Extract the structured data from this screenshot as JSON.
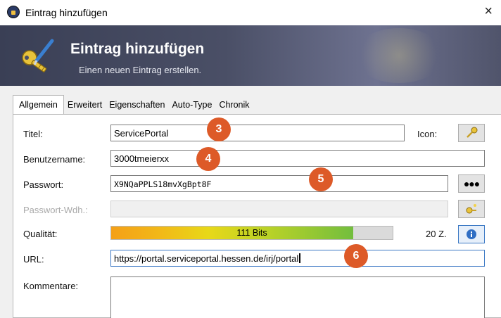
{
  "window": {
    "title": "Eintrag hinzufügen",
    "close_label": "×"
  },
  "banner": {
    "heading": "Eintrag hinzufügen",
    "subheading": "Einen neuen Eintrag erstellen."
  },
  "tabs": [
    {
      "label": "Allgemein",
      "active": true
    },
    {
      "label": "Erweitert",
      "active": false
    },
    {
      "label": "Eigenschaften",
      "active": false
    },
    {
      "label": "Auto-Type",
      "active": false
    },
    {
      "label": "Chronik",
      "active": false
    }
  ],
  "form": {
    "title_label": "Titel:",
    "title_value": "ServicePortal",
    "icon_label": "Icon:",
    "username_label": "Benutzername:",
    "username_value": "3000tmeierxx",
    "password_label": "Passwort:",
    "password_value": "X9NQaPPLS18mvXgBpt8F",
    "password_repeat_label": "Passwort-Wdh.:",
    "password_repeat_value": "",
    "quality_label": "Qualität:",
    "quality_text": "111 Bits",
    "quality_fraction": 0.86,
    "char_count": "20 Z.",
    "url_label": "URL:",
    "url_value": "https://portal.serviceportal.hessen.de/irj/portal",
    "comments_label": "Kommentare:",
    "comments_value": ""
  },
  "annotations": [
    "3",
    "4",
    "5",
    "6"
  ],
  "icons": {
    "app": "lock-icon",
    "banner": "key-pen-icon",
    "icon_picker": "key-icon",
    "show_password": "dots-icon",
    "generate_password": "key-generate-icon",
    "info": "info-icon"
  },
  "colors": {
    "badge": "#dd5a28",
    "banner": "#44495f",
    "focus_border": "#3b78c4"
  }
}
